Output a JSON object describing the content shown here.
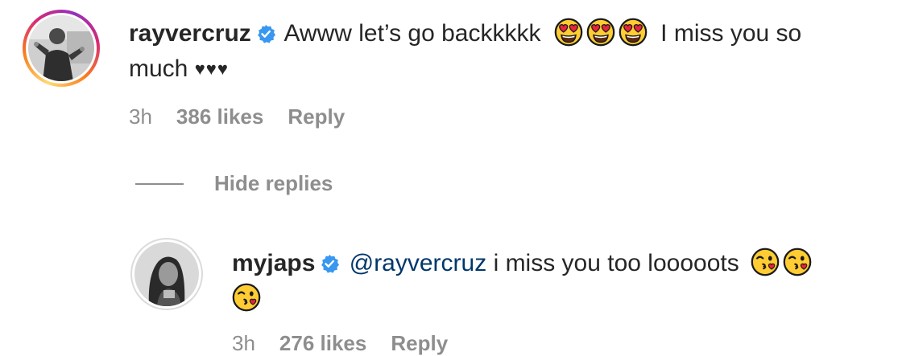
{
  "comments": [
    {
      "username": "rayvercruz",
      "text": "Awww let’s go backkkkk",
      "text_after_emojis": "I miss you so",
      "text_line2": "much",
      "hearts": "♥♥♥",
      "time": "3h",
      "likes": "386 likes",
      "reply_label": "Reply"
    }
  ],
  "hide_replies_label": "Hide replies",
  "reply": {
    "username": "myjaps",
    "mention": "@rayvercruz",
    "text": "i miss you too looooots",
    "time": "3h",
    "likes": "276 likes",
    "reply_label": "Reply"
  },
  "icons": {
    "verified": "verified-badge-icon",
    "heart_eyes": "heart-eyes-emoji-icon",
    "kissing_wink": "face-blowing-kiss-emoji-icon"
  },
  "colors": {
    "verified_blue": "#3897f0",
    "muted_text": "#8e8e8e",
    "mention": "#00376b",
    "text": "#262626"
  }
}
